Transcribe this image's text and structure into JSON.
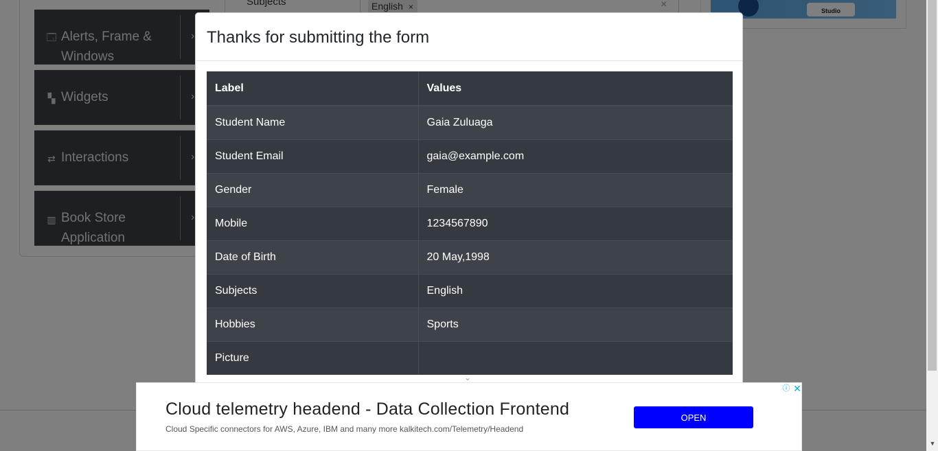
{
  "sidebar": {
    "groups": [
      {
        "label_line1": "Alerts, Frame &",
        "label_line2": "Windows",
        "icon": "window-icon"
      },
      {
        "label_line1": "Widgets",
        "label_line2": "",
        "icon": "widgets-icon"
      },
      {
        "label_line1": "Interactions",
        "label_line2": "",
        "icon": "interactions-icon"
      },
      {
        "label_line1": "Book Store",
        "label_line2": "Application",
        "icon": "books-icon"
      }
    ]
  },
  "form": {
    "subjects_label": "Subjects",
    "subject_chip": "English",
    "chip_remove": "×",
    "clear": "×"
  },
  "ad_right": {
    "studio_text": "Studio"
  },
  "modal": {
    "title": "Thanks for submitting the form",
    "table": {
      "headers": [
        "Label",
        "Values"
      ],
      "rows": [
        [
          "Student Name",
          "Gaia Zuluaga"
        ],
        [
          "Student Email",
          "gaia@example.com"
        ],
        [
          "Gender",
          "Female"
        ],
        [
          "Mobile",
          "1234567890"
        ],
        [
          "Date of Birth",
          "20 May,1998"
        ],
        [
          "Subjects",
          "English"
        ],
        [
          "Hobbies",
          "Sports"
        ],
        [
          "Picture",
          ""
        ]
      ]
    }
  },
  "ad_bottom": {
    "title": "Cloud telemetry headend - Data Collection Frontend",
    "description": "Cloud Specific connectors for AWS, Azure, IBM and many more kalkitech.com/Telemetry/Headend",
    "button": "OPEN",
    "info_icon": "info-icon",
    "close_icon": "close-icon"
  },
  "colors": {
    "table_bg": "#343a40",
    "ad_button": "#0000ff",
    "sidebar_bg": "#3b3f44"
  }
}
